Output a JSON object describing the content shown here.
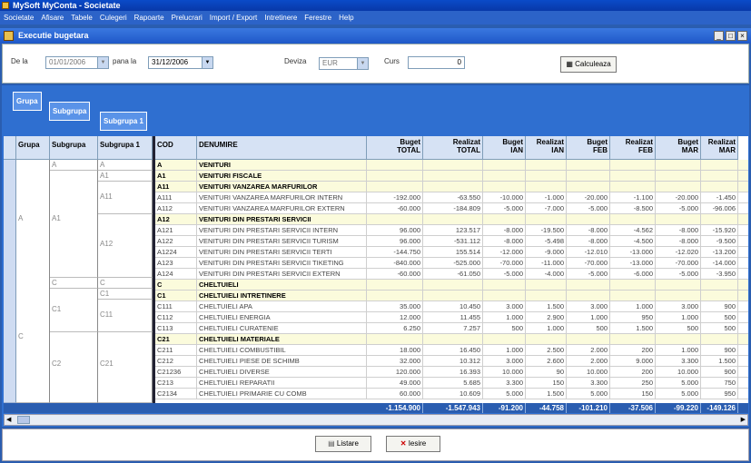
{
  "app": {
    "title": "MySoft MyConta - Societate"
  },
  "menu": [
    "Societate",
    "Afisare",
    "Tabele",
    "Culegeri",
    "Rapoarte",
    "Prelucrari",
    "Import / Export",
    "Intretinere",
    "Ferestre",
    "Help"
  ],
  "window": {
    "title": "Executie bugetara"
  },
  "filters": {
    "from_label": "De la",
    "from_value": "01/01/2006",
    "to_label": "pana la",
    "to_value": "31/12/2006",
    "currency_label": "Deviza",
    "currency_value": "EUR",
    "rate_label": "Curs",
    "rate_value": "0",
    "calculate": "Calculeaza"
  },
  "grouping": {
    "grupa": "Grupa",
    "subgrupa": "Subgrupa",
    "subgrupa1": "Subgrupa 1"
  },
  "columns": {
    "grupa": "Grupa",
    "subgrupa": "Subgrupa",
    "subgrupa1": "Subgrupa 1",
    "cod": "COD",
    "denumire": "DENUMIRE",
    "numeric": [
      [
        "Buget",
        "TOTAL"
      ],
      [
        "Realizat",
        "TOTAL"
      ],
      [
        "Buget",
        "IAN"
      ],
      [
        "Realizat",
        "IAN"
      ],
      [
        "Buget",
        "FEB"
      ],
      [
        "Realizat",
        "FEB"
      ],
      [
        "Buget",
        "MAR"
      ],
      [
        "Realizat",
        "MAR"
      ]
    ]
  },
  "left": {
    "r1": [
      "A",
      "A"
    ],
    "r2": [
      "A1"
    ],
    "r3": [
      "A11"
    ],
    "r4": [
      "A12"
    ],
    "r5": [
      "A"
    ],
    "r6": [
      "A1"
    ],
    "r7": [
      "C",
      "C"
    ],
    "r8": [
      "C1"
    ],
    "r9": [
      "C11"
    ],
    "r10": [
      "C1"
    ],
    "r11": [
      "C21"
    ],
    "r12": [
      "C2"
    ],
    "r13": [
      "C"
    ]
  },
  "rows": [
    {
      "cod": "A",
      "den": "VENITURI",
      "g": true,
      "v": [
        "",
        "",
        "",
        "",
        "",
        "",
        "",
        ""
      ]
    },
    {
      "cod": "A1",
      "den": "VENITURI FISCALE",
      "g": true,
      "v": [
        "",
        "",
        "",
        "",
        "",
        "",
        "",
        ""
      ]
    },
    {
      "cod": "A11",
      "den": "VENITURI VANZAREA MARFURILOR",
      "g": true,
      "v": [
        "",
        "",
        "",
        "",
        "",
        "",
        "",
        ""
      ]
    },
    {
      "cod": "A111",
      "den": "VENITURI VANZAREA MARFURILOR INTERN",
      "g": false,
      "v": [
        "-192.000",
        "-63.550",
        "-10.000",
        "-1.000",
        "-20.000",
        "-1.100",
        "-20.000",
        "-1.450"
      ]
    },
    {
      "cod": "A112",
      "den": "VENITURI VANZAREA MARFURILOR EXTERN",
      "g": false,
      "v": [
        "-60.000",
        "-184.809",
        "-5.000",
        "-7.000",
        "-5.000",
        "-8.500",
        "-5.000",
        "-96.006"
      ]
    },
    {
      "cod": "A12",
      "den": "VENITURI DIN PRESTARI SERVICII",
      "g": true,
      "v": [
        "",
        "",
        "",
        "",
        "",
        "",
        "",
        ""
      ]
    },
    {
      "cod": "A121",
      "den": "VENITURI DIN PRESTARI SERVICII INTERN",
      "g": false,
      "v": [
        "96.000",
        "123.517",
        "-8.000",
        "-19.500",
        "-8.000",
        "-4.562",
        "-8.000",
        "-15.920"
      ]
    },
    {
      "cod": "A122",
      "den": "VENITURI DIN PRESTARI SERVICII TURISM",
      "g": false,
      "v": [
        "96.000",
        "-531.112",
        "-8.000",
        "-5.498",
        "-8.000",
        "-4.500",
        "-8.000",
        "-9.500"
      ]
    },
    {
      "cod": "A1224",
      "den": "VENITURI DIN PRESTARI SERVICII TERTI",
      "g": false,
      "v": [
        "-144.750",
        "155.514",
        "-12.000",
        "-9.000",
        "-12.010",
        "-13.000",
        "-12.020",
        "-13.200"
      ]
    },
    {
      "cod": "A123",
      "den": "VENITURI DIN PRESTARI SERVICII TIKETING",
      "g": false,
      "v": [
        "-840.000",
        "-525.000",
        "-70.000",
        "-11.000",
        "-70.000",
        "-13.000",
        "-70.000",
        "-14.000"
      ]
    },
    {
      "cod": "A124",
      "den": "VENITURI DIN PRESTARI SERVICII EXTERN",
      "g": false,
      "v": [
        "-60.000",
        "-61.050",
        "-5.000",
        "-4.000",
        "-5.000",
        "-6.000",
        "-5.000",
        "-3.950"
      ]
    },
    {
      "cod": "C",
      "den": "CHELTUIELI",
      "g": true,
      "v": [
        "",
        "",
        "",
        "",
        "",
        "",
        "",
        ""
      ]
    },
    {
      "cod": "C1",
      "den": "CHELTUIELI INTRETINERE",
      "g": true,
      "v": [
        "",
        "",
        "",
        "",
        "",
        "",
        "",
        ""
      ]
    },
    {
      "cod": "C111",
      "den": "CHELTUIELI APA",
      "g": false,
      "v": [
        "35.000",
        "10.450",
        "3.000",
        "1.500",
        "3.000",
        "1.000",
        "3.000",
        "900"
      ]
    },
    {
      "cod": "C112",
      "den": "CHELTUIELI ENERGIA",
      "g": false,
      "v": [
        "12.000",
        "11.455",
        "1.000",
        "2.900",
        "1.000",
        "950",
        "1.000",
        "500"
      ]
    },
    {
      "cod": "C113",
      "den": "CHELTUIELI CURATENIE",
      "g": false,
      "v": [
        "6.250",
        "7.257",
        "500",
        "1.000",
        "500",
        "1.500",
        "500",
        "500"
      ]
    },
    {
      "cod": "C21",
      "den": "CHELTUIELI MATERIALE",
      "g": true,
      "v": [
        "",
        "",
        "",
        "",
        "",
        "",
        "",
        ""
      ]
    },
    {
      "cod": "C211",
      "den": "CHELTUIELI COMBUSTIBIL",
      "g": false,
      "v": [
        "18.000",
        "16.450",
        "1.000",
        "2.500",
        "2.000",
        "200",
        "1.000",
        "900"
      ]
    },
    {
      "cod": "C212",
      "den": "CHELTUIELI PIESE DE SCHIMB",
      "g": false,
      "v": [
        "32.000",
        "10.312",
        "3.000",
        "2.600",
        "2.000",
        "9.000",
        "3.300",
        "1.500"
      ]
    },
    {
      "cod": "C21236",
      "den": "CHELTUIELI DIVERSE",
      "g": false,
      "v": [
        "120.000",
        "16.393",
        "10.000",
        "90",
        "10.000",
        "200",
        "10.000",
        "900"
      ]
    },
    {
      "cod": "C213",
      "den": "CHELTUIELI REPARATII",
      "g": false,
      "v": [
        "49.000",
        "5.685",
        "3.300",
        "150",
        "3.300",
        "250",
        "5.000",
        "750"
      ]
    },
    {
      "cod": "C2134",
      "den": "CHELTUIELI PRIMARIE CU COMB",
      "g": false,
      "v": [
        "60.000",
        "10.609",
        "5.000",
        "1.500",
        "5.000",
        "150",
        "5.000",
        "950"
      ]
    }
  ],
  "totals": [
    "-1.154.900",
    "-1.547.943",
    "-91.200",
    "-44.758",
    "-101.210",
    "-37.506",
    "-99.220",
    "-149.126"
  ],
  "buttons": {
    "print": "Listare",
    "exit": "Iesire"
  },
  "colors": {
    "title_bar": "#0a4bc8",
    "panel": "#2f6fd0",
    "group_row": "#fbfbdc",
    "header": "#d6e2f4"
  }
}
